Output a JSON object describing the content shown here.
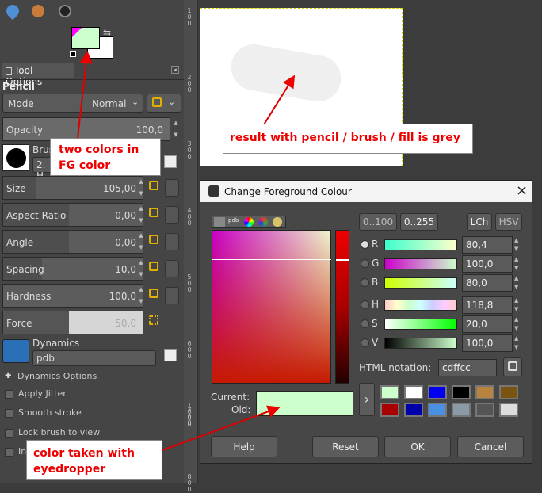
{
  "toolbox": {
    "tool_options_tab": "Tool Options",
    "tool_name": "Pencil",
    "mode_label": "Mode",
    "mode_value": "Normal",
    "opacity": {
      "label": "Opacity",
      "value": "100,0"
    },
    "brush_label": "Brus",
    "brush_name": "2. H",
    "size": {
      "label": "Size",
      "value": "105,00"
    },
    "aspect": {
      "label": "Aspect Ratio",
      "value": "0,00"
    },
    "angle": {
      "label": "Angle",
      "value": "0,00"
    },
    "spacing": {
      "label": "Spacing",
      "value": "10,0"
    },
    "hardness": {
      "label": "Hardness",
      "value": "100,0"
    },
    "force": {
      "label": "Force",
      "value": "50,0"
    },
    "dynamics_label": "Dynamics",
    "dynamics_value": "pdb",
    "dynamics_options": "Dynamics Options",
    "apply_jitter": "Apply Jitter",
    "smooth_stroke": "Smooth stroke",
    "lock_brush": "Lock brush to view",
    "incremental": "In",
    "fg_color": "#cdffcc",
    "bg_color": "#ffffff"
  },
  "ruler": {
    "marks": [
      "1",
      "0",
      "0",
      "2",
      "0",
      "0",
      "3",
      "0",
      "0",
      "4",
      "0",
      "0",
      "5",
      "0",
      "0",
      "6",
      "0",
      "0",
      "7",
      "0",
      "0",
      "8",
      "0",
      "0",
      "1",
      "0",
      "0",
      "0"
    ]
  },
  "dialog": {
    "title": "Change Foreground Colour",
    "close": "×",
    "range_a": "0..100",
    "range_b": "0..255",
    "lch": "LCh",
    "hsv": "HSV",
    "channels": [
      {
        "name": "R",
        "value": "80,4"
      },
      {
        "name": "G",
        "value": "100,0"
      },
      {
        "name": "B",
        "value": "80,0"
      },
      {
        "name": "H",
        "value": "118,8"
      },
      {
        "name": "S",
        "value": "20,0"
      },
      {
        "name": "V",
        "value": "100,0"
      }
    ],
    "html_notation_label": "HTML notation:",
    "html_notation_value": "cdffcc",
    "current_label": "Current:",
    "old_label": "Old:",
    "current_color": "#cdffcc",
    "history": [
      "#cdffcc",
      "#ffffff",
      "#0000ee",
      "#000000",
      "#b8843d",
      "#7a5511",
      "#aa0000",
      "#0000aa",
      "#4a90e2",
      "#8c99a6",
      "#555555",
      "#dddddd"
    ],
    "help": "Help",
    "reset": "Reset",
    "ok": "OK",
    "cancel": "Cancel",
    "pdb_tab": "pdb"
  },
  "annotations": {
    "two_colors": "two colors in\nFG color",
    "result": "result with pencil / brush / fill is grey",
    "eyedropper": "color taken with\neyedropper"
  }
}
